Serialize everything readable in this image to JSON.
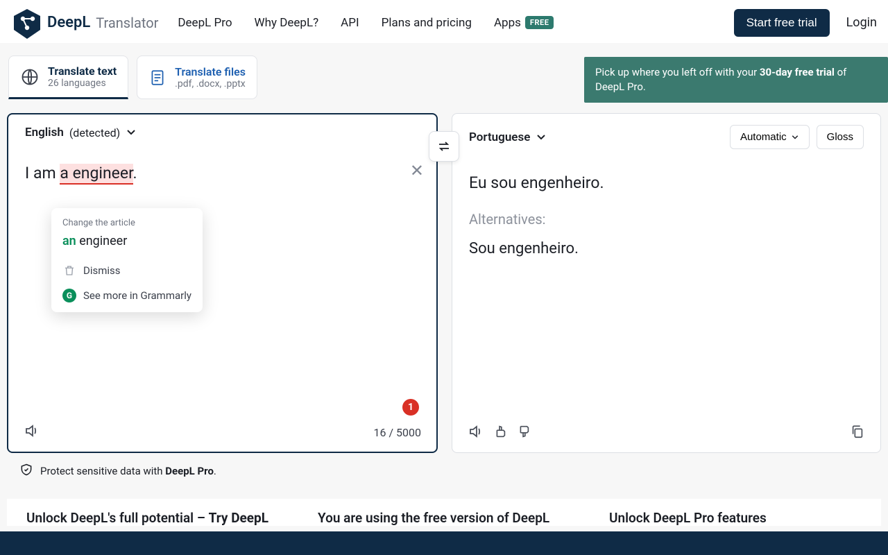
{
  "header": {
    "brand": "DeepL",
    "brand_sub": "Translator",
    "nav": {
      "pro": "DeepL Pro",
      "why": "Why DeepL?",
      "api": "API",
      "plans": "Plans and pricing",
      "apps": "Apps",
      "free_badge": "FREE"
    },
    "start_trial": "Start free trial",
    "login": "Login"
  },
  "tabs": {
    "text": {
      "title": "Translate text",
      "sub": "26 languages"
    },
    "files": {
      "title": "Translate files",
      "sub": ".pdf, .docx, .pptx"
    }
  },
  "banner": {
    "pre": "Pick up where you left off with your ",
    "bold": "30-day free trial",
    "post": " of DeepL Pro."
  },
  "source": {
    "lang": "English",
    "detected": "(detected)",
    "text_pre": "I am ",
    "text_err": "a engineer",
    "text_post": ".",
    "char_count": "16 / 5000"
  },
  "target": {
    "lang": "Portuguese",
    "automatic": "Automatic",
    "glossary": "Gloss",
    "text": "Eu sou engenheiro.",
    "alt_label": "Alternatives:",
    "alt1": "Sou engenheiro."
  },
  "grammarly": {
    "title": "Change the article",
    "sugg_an": "an",
    "sugg_rest": " engineer",
    "dismiss": "Dismiss",
    "more": "See more in Grammarly"
  },
  "badge_count": "1",
  "protect": {
    "pre": "Protect sensitive data with ",
    "bold": "DeepL Pro",
    "post": "."
  },
  "bottom": {
    "c1_pre": "Unlock DeepL's full potential – ",
    "c1_bold": "Try DeepL",
    "c2": "You are using the free version of DeepL",
    "c3": "Unlock DeepL Pro features"
  }
}
